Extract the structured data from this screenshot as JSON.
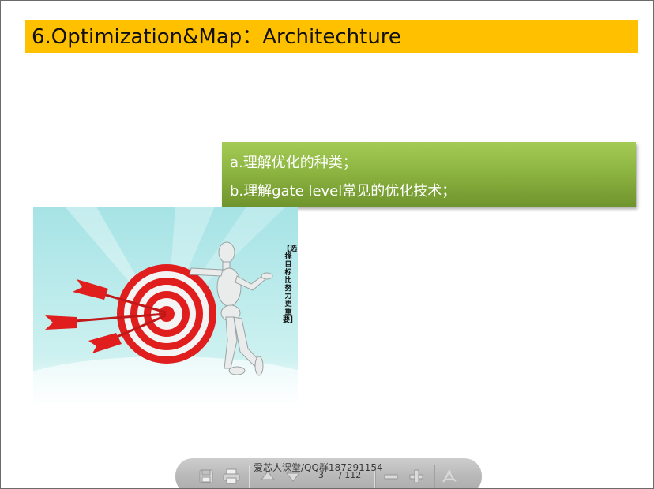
{
  "slide": {
    "title": "6.Optimization&Map：Architechture",
    "points": [
      "a.理解优化的种类；",
      "b.理解gate level常见的优化技术；"
    ],
    "image_caption": "【选择目标比努力更重要】"
  },
  "viewer": {
    "watermark": "爱芯人课堂/QQ群187291154",
    "current_page": "3",
    "total_pages": "/ 112",
    "icons": [
      "save-icon",
      "print-icon",
      "previous-page-icon",
      "next-page-icon",
      "zoom-out-icon",
      "zoom-in-icon",
      "acrobat-icon"
    ]
  },
  "colors": {
    "title_bar": "#ffc000",
    "green_box_top": "#a4cb56",
    "green_box_bottom": "#6f942d",
    "target_red": "#e01e1e",
    "sky": "#aee7ea"
  }
}
